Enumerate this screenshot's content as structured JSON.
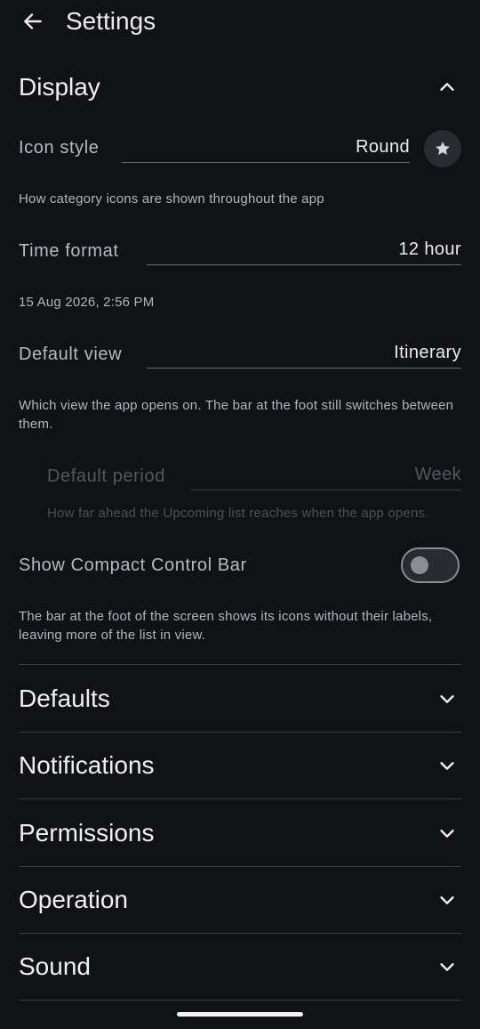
{
  "header": {
    "title": "Settings"
  },
  "display": {
    "title": "Display",
    "icon_style": {
      "label": "Icon style",
      "value": "Round",
      "helper": "How category icons are shown throughout the app"
    },
    "time_format": {
      "label": "Time format",
      "value": "12 hour",
      "helper": "15 Aug 2026, 2:56 PM"
    },
    "default_view": {
      "label": "Default view",
      "value": "Itinerary",
      "helper": "Which view the app opens on. The bar at the foot still switches between them."
    },
    "default_period": {
      "label": "Default period",
      "value": "Week",
      "helper": "How far ahead the Upcoming list reaches when the app opens."
    },
    "compact_bar": {
      "label": "Show Compact Control Bar",
      "enabled": false,
      "helper": "The bar at the foot of the screen shows its icons without their labels, leaving more of the list in view."
    }
  },
  "sections": [
    {
      "title": "Defaults"
    },
    {
      "title": "Notifications"
    },
    {
      "title": "Permissions"
    },
    {
      "title": "Operation"
    },
    {
      "title": "Sound"
    }
  ],
  "colors": {
    "background": "#111216",
    "text": "#ececf0",
    "secondary_text": "#b8b9c0",
    "disabled_text": "#55565c",
    "divider": "#3c3d43"
  },
  "icons": {
    "back": "arrow-left-icon",
    "collapse": "chevron-up-icon",
    "expand": "chevron-down-icon",
    "favorite": "star-icon"
  }
}
